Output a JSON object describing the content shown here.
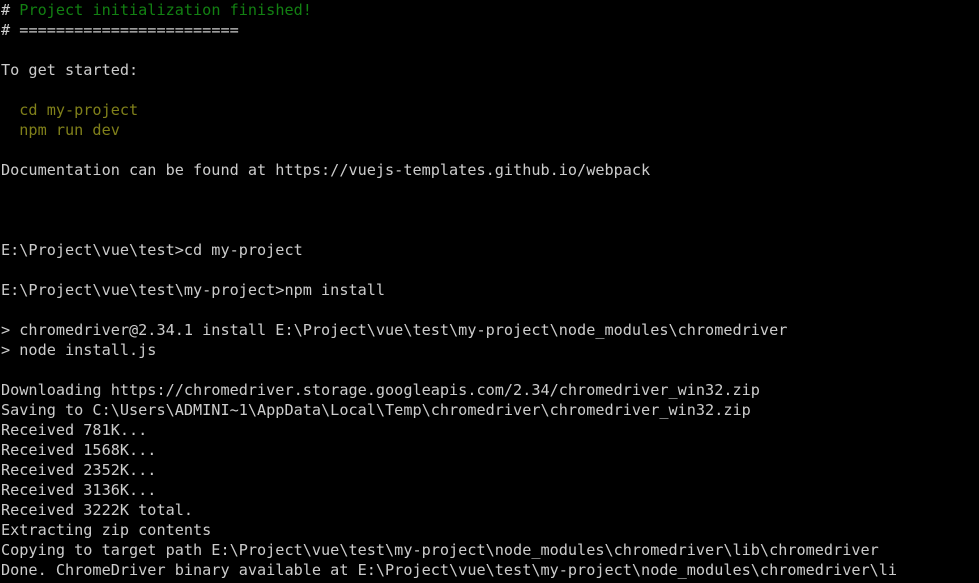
{
  "terminal": {
    "title": "Windows Command Prompt",
    "background_color": "#000000",
    "default_text_color": "#cccccc",
    "green_color": "#128012",
    "yellow_color": "#80801a",
    "lines": [
      {
        "id": "l01",
        "name": "line-project-init-finished",
        "segments": [
          {
            "text": "# ",
            "color": "white"
          },
          {
            "text": "Project initialization finished!",
            "color": "green"
          }
        ]
      },
      {
        "id": "l02",
        "name": "line-separator-rule",
        "segments": [
          {
            "text": "# ",
            "color": "white"
          },
          {
            "text": "========================",
            "color": "white"
          }
        ]
      },
      {
        "id": "l03",
        "name": "line-blank-1",
        "segments": [
          {
            "text": "",
            "color": "white"
          }
        ]
      },
      {
        "id": "l04",
        "name": "line-to-get-started",
        "segments": [
          {
            "text": "To get started:",
            "color": "white"
          }
        ]
      },
      {
        "id": "l05",
        "name": "line-blank-2",
        "segments": [
          {
            "text": "",
            "color": "white"
          }
        ]
      },
      {
        "id": "l06",
        "name": "line-cmd-cd-my-project",
        "segments": [
          {
            "text": "  cd my-project",
            "color": "yellow"
          }
        ]
      },
      {
        "id": "l07",
        "name": "line-cmd-npm-run-dev",
        "segments": [
          {
            "text": "  npm run dev",
            "color": "yellow"
          }
        ]
      },
      {
        "id": "l08",
        "name": "line-blank-3",
        "segments": [
          {
            "text": "",
            "color": "white"
          }
        ]
      },
      {
        "id": "l09",
        "name": "line-documentation-url",
        "segments": [
          {
            "text": "Documentation can be found at https://vuejs-templates.github.io/webpack",
            "color": "white"
          }
        ]
      },
      {
        "id": "l10",
        "name": "line-blank-4",
        "segments": [
          {
            "text": "",
            "color": "white"
          }
        ]
      },
      {
        "id": "l11",
        "name": "line-blank-5",
        "segments": [
          {
            "text": "",
            "color": "white"
          }
        ]
      },
      {
        "id": "l12",
        "name": "line-blank-6",
        "segments": [
          {
            "text": "",
            "color": "white"
          }
        ]
      },
      {
        "id": "l13",
        "name": "line-prompt-cd-my-project",
        "segments": [
          {
            "text": "E:\\Project\\vue\\test>cd my-project",
            "color": "white"
          }
        ]
      },
      {
        "id": "l14",
        "name": "line-blank-7",
        "segments": [
          {
            "text": "",
            "color": "white"
          }
        ]
      },
      {
        "id": "l15",
        "name": "line-prompt-npm-install",
        "segments": [
          {
            "text": "E:\\Project\\vue\\test\\my-project>npm install",
            "color": "white"
          }
        ]
      },
      {
        "id": "l16",
        "name": "line-blank-8",
        "segments": [
          {
            "text": "",
            "color": "white"
          }
        ]
      },
      {
        "id": "l17",
        "name": "line-chromedriver-install-hook",
        "segments": [
          {
            "text": "> chromedriver@2.34.1 install E:\\Project\\vue\\test\\my-project\\node_modules\\chromedriver",
            "color": "white"
          }
        ]
      },
      {
        "id": "l18",
        "name": "line-node-install-js",
        "segments": [
          {
            "text": "> node install.js",
            "color": "white"
          }
        ]
      },
      {
        "id": "l19",
        "name": "line-blank-9",
        "segments": [
          {
            "text": "",
            "color": "white"
          }
        ]
      },
      {
        "id": "l20",
        "name": "line-downloading-url",
        "segments": [
          {
            "text": "Downloading https://chromedriver.storage.googleapis.com/2.34/chromedriver_win32.zip",
            "color": "white"
          }
        ]
      },
      {
        "id": "l21",
        "name": "line-saving-to-path",
        "segments": [
          {
            "text": "Saving to C:\\Users\\ADMINI~1\\AppData\\Local\\Temp\\chromedriver\\chromedriver_win32.zip",
            "color": "white"
          }
        ]
      },
      {
        "id": "l22",
        "name": "line-received-781k",
        "segments": [
          {
            "text": "Received 781K...",
            "color": "white"
          }
        ]
      },
      {
        "id": "l23",
        "name": "line-received-1568k",
        "segments": [
          {
            "text": "Received 1568K...",
            "color": "white"
          }
        ]
      },
      {
        "id": "l24",
        "name": "line-received-2352k",
        "segments": [
          {
            "text": "Received 2352K...",
            "color": "white"
          }
        ]
      },
      {
        "id": "l25",
        "name": "line-received-3136k",
        "segments": [
          {
            "text": "Received 3136K...",
            "color": "white"
          }
        ]
      },
      {
        "id": "l26",
        "name": "line-received-total",
        "segments": [
          {
            "text": "Received 3222K total.",
            "color": "white"
          }
        ]
      },
      {
        "id": "l27",
        "name": "line-extracting-zip",
        "segments": [
          {
            "text": "Extracting zip contents",
            "color": "white"
          }
        ]
      },
      {
        "id": "l28",
        "name": "line-copying-to-target-path",
        "segments": [
          {
            "text": "Copying to target path E:\\Project\\vue\\test\\my-project\\node_modules\\chromedriver\\lib\\chromedriver",
            "color": "white"
          }
        ]
      },
      {
        "id": "l29",
        "name": "line-done-binary-available",
        "segments": [
          {
            "text": "Done. ChromeDriver binary available at E:\\Project\\vue\\test\\my-project\\node_modules\\chromedriver\\li",
            "color": "white"
          }
        ]
      }
    ]
  }
}
